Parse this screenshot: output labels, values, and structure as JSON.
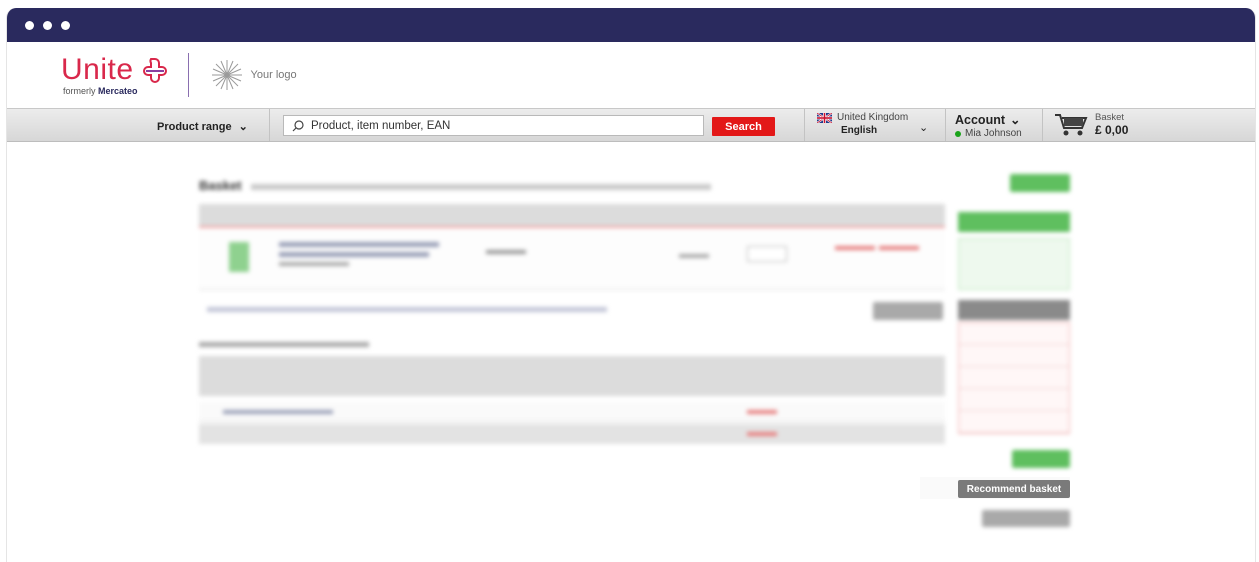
{
  "brand": {
    "name": "Unite",
    "formerly_prefix": "formerly",
    "formerly_name": "Mercateo",
    "partner_logo_text": "Your logo"
  },
  "nav": {
    "product_range": "Product range",
    "search_placeholder": "Product, item number, EAN",
    "search_button": "Search",
    "country": "United Kingdom",
    "language": "English",
    "account_title": "Account",
    "account_user": "Mia Johnson",
    "basket_label": "Basket",
    "basket_total": "£ 0,00"
  },
  "basket": {
    "heading": "Basket",
    "recommend_button": "Recommend basket"
  },
  "colors": {
    "titlebar": "#2a2a5e",
    "brand_red": "#d9284b",
    "search_red": "#e31818",
    "checkout_green": "#5fbf5f",
    "online_green": "#1aa31a"
  }
}
